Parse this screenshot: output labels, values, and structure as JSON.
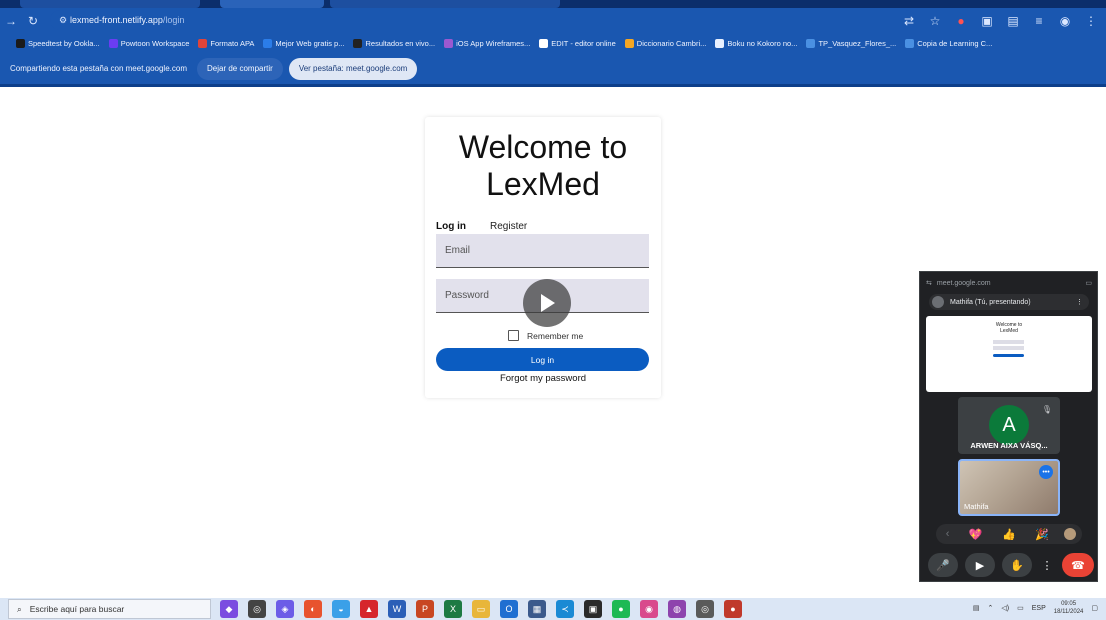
{
  "browser": {
    "url_host": "lexmed-front.netlify.app",
    "url_path": "/login",
    "bookmarks": [
      {
        "label": "Speedtest by Ookla...",
        "color": "#1b1b1b"
      },
      {
        "label": "Powtoon Workspace",
        "color": "#6a3df2"
      },
      {
        "label": "Formato APA",
        "color": "#e0443a"
      },
      {
        "label": "Mejor Web gratis p...",
        "color": "#2b7de9"
      },
      {
        "label": "Resultados en vivo...",
        "color": "#222222"
      },
      {
        "label": "iOS App Wireframes...",
        "color": "#9b59d0"
      },
      {
        "label": "EDIT - editor online",
        "color": "#ffffff"
      },
      {
        "label": "Diccionario Cambri...",
        "color": "#f5a623"
      },
      {
        "label": "Boku no Kokoro no...",
        "color": "#e8f0ff"
      },
      {
        "label": "TP_Vasquez_Flores_...",
        "color": "#4a90e2"
      },
      {
        "label": "Copia de Learning C...",
        "color": "#4a90e2"
      }
    ]
  },
  "share_bar": {
    "text": "Compartiendo esta pestaña con meet.google.com",
    "stop_label": "Dejar de compartir",
    "view_label": "Ver pestaña: meet.google.com"
  },
  "login": {
    "title": "Welcome to LexMed",
    "tab_login": "Log in",
    "tab_register": "Register",
    "email_placeholder": "Email",
    "password_placeholder": "Password",
    "remember": "Remember me",
    "submit": "Log in",
    "forgot": "Forgot my password",
    "accent": "#0b5cc1"
  },
  "meet": {
    "pip_url": "meet.google.com",
    "presenting": "Mathifa (Tú, presentando)",
    "preview_title": "Welcome to LexMed",
    "participant_initial": "A",
    "participant_name": "ARWEN AIXA VÁSQ...",
    "self_name": "Mathifa",
    "reactions": [
      "💖",
      "👍",
      "🎉"
    ]
  },
  "taskbar": {
    "search_placeholder": "Escribe aquí para buscar",
    "language": "ESP",
    "time": "09:05",
    "date": "18/11/2024"
  }
}
